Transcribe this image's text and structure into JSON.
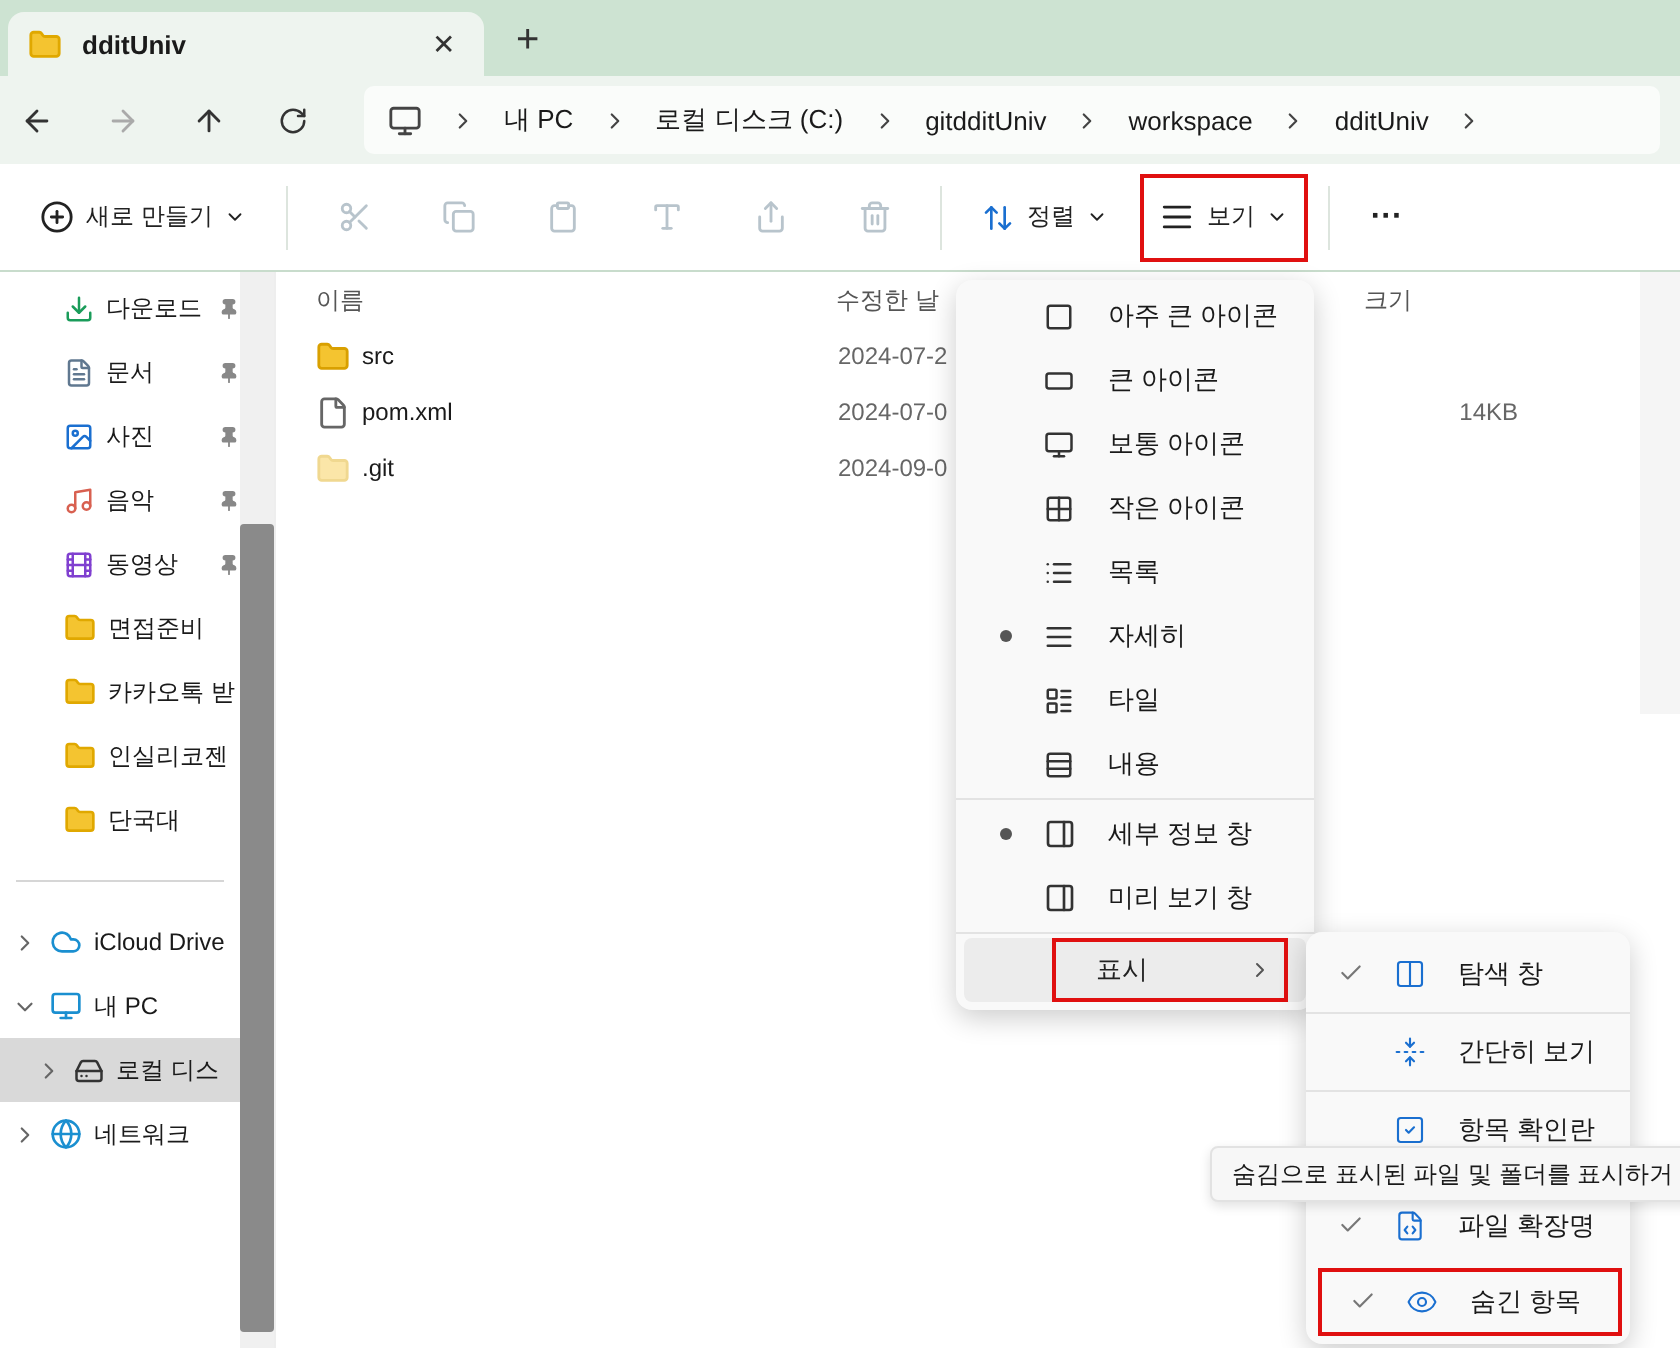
{
  "tab": {
    "title": "dditUniv",
    "close": "✕",
    "new_tab": "+"
  },
  "breadcrumb": [
    "내 PC",
    "로컬 디스크 (C:)",
    "gitdditUniv",
    "workspace",
    "dditUniv"
  ],
  "toolbar": {
    "new": "새로 만들기",
    "actions": [
      {
        "disabled": true
      },
      {
        "disabled": true
      },
      {
        "disabled": true
      },
      {
        "disabled": true
      },
      {
        "disabled": true
      },
      {
        "disabled": true
      }
    ],
    "sort": "정렬",
    "view": {
      "label": "보기",
      "highlighted": true
    },
    "more": "···"
  },
  "sidebar": {
    "quick": [
      {
        "label": "다운로드",
        "pinned": true
      },
      {
        "label": "문서",
        "pinned": true
      },
      {
        "label": "사진",
        "pinned": true
      },
      {
        "label": "음악",
        "pinned": true
      },
      {
        "label": "동영상",
        "pinned": true
      },
      {
        "label": "면접준비",
        "pinned": false
      },
      {
        "label": "카카오톡 받",
        "pinned": false
      },
      {
        "label": "인실리코젠",
        "pinned": false
      },
      {
        "label": "단국대",
        "pinned": false
      }
    ],
    "tree": [
      {
        "label": "iCloud Drive",
        "expanded": false,
        "selected": false
      },
      {
        "label": "내 PC",
        "expanded": true,
        "selected": false,
        "children": [
          {
            "label": "로컬 디스",
            "expanded": false,
            "selected": true
          }
        ]
      },
      {
        "label": "네트워크",
        "expanded": false,
        "selected": false
      }
    ]
  },
  "table": {
    "columns": [
      "이름",
      "수정한 날",
      "크기"
    ],
    "rows": [
      {
        "kind": "warning-folder",
        "name": "src",
        "date": "2024-07-2",
        "size": ""
      },
      {
        "kind": "file",
        "name": "pom.xml",
        "date": "2024-07-0",
        "size": "14KB"
      },
      {
        "kind": "hidden-folder",
        "name": ".git",
        "date": "2024-09-0",
        "size": ""
      }
    ]
  },
  "view_menu": {
    "layouts": [
      {
        "label": "아주 큰 아이콘",
        "selected": false
      },
      {
        "label": "큰 아이콘",
        "selected": false
      },
      {
        "label": "보통 아이콘",
        "selected": false
      },
      {
        "label": "작은 아이콘",
        "selected": false
      },
      {
        "label": "목록",
        "selected": false
      },
      {
        "label": "자세히",
        "selected": true
      },
      {
        "label": "타일",
        "selected": false
      },
      {
        "label": "내용",
        "selected": false
      }
    ],
    "panes": [
      {
        "label": "세부 정보 창",
        "selected": true
      },
      {
        "label": "미리 보기 창",
        "selected": false
      }
    ],
    "show": {
      "label": "표시",
      "highlighted": true
    }
  },
  "show_menu": [
    {
      "label": "탐색 창",
      "checked": true,
      "highlighted": false
    },
    {
      "label": "간단히 보기",
      "checked": false,
      "highlighted": false
    },
    {
      "label": "항목 확인란",
      "checked": false,
      "highlighted": false
    },
    {
      "label": "파일 확장명",
      "checked": true,
      "highlighted": false
    },
    {
      "label": "숨긴 항목",
      "checked": true,
      "highlighted": true
    }
  ],
  "tooltip": "숨김으로 표시된 파일 및 폴더를 표시하거"
}
